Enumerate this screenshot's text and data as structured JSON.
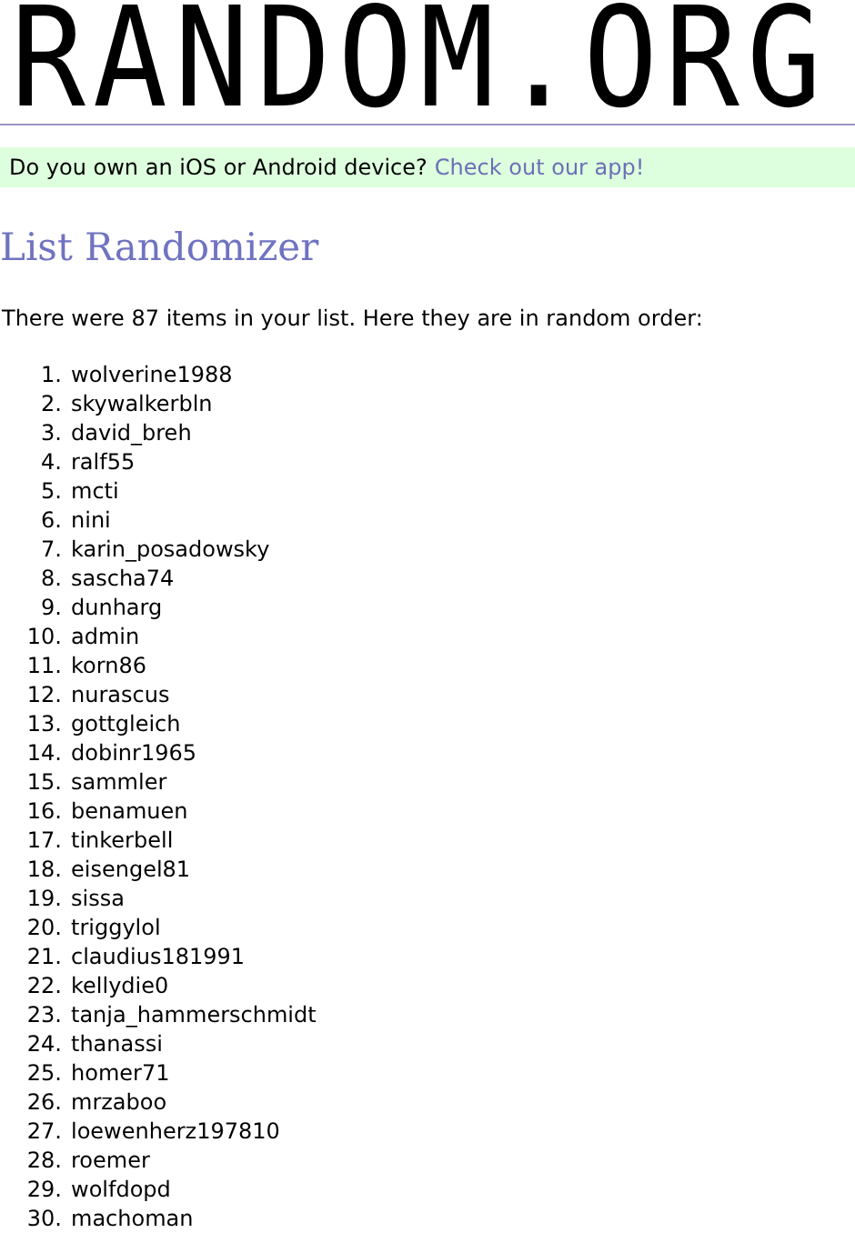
{
  "logo": "RANDOM.ORG",
  "banner": {
    "text": "Do you own an iOS or Android device?",
    "link": "Check out our app!"
  },
  "title": "List Randomizer",
  "intro": "There were 87 items in your list. Here they are in random order:",
  "items": [
    {
      "number": "1.",
      "name": "wolverine1988"
    },
    {
      "number": "2.",
      "name": "skywalkerbln"
    },
    {
      "number": "3.",
      "name": "david_breh"
    },
    {
      "number": "4.",
      "name": "ralf55"
    },
    {
      "number": "5.",
      "name": "mcti"
    },
    {
      "number": "6.",
      "name": "nini"
    },
    {
      "number": "7.",
      "name": "karin_posadowsky"
    },
    {
      "number": "8.",
      "name": "sascha74"
    },
    {
      "number": "9.",
      "name": "dunharg"
    },
    {
      "number": "10.",
      "name": "admin"
    },
    {
      "number": "11.",
      "name": "korn86"
    },
    {
      "number": "12.",
      "name": "nurascus"
    },
    {
      "number": "13.",
      "name": "gottgleich"
    },
    {
      "number": "14.",
      "name": "dobinr1965"
    },
    {
      "number": "15.",
      "name": "sammler"
    },
    {
      "number": "16.",
      "name": "benamuen"
    },
    {
      "number": "17.",
      "name": "tinkerbell"
    },
    {
      "number": "18.",
      "name": "eisengel81"
    },
    {
      "number": "19.",
      "name": "sissa"
    },
    {
      "number": "20.",
      "name": "triggylol"
    },
    {
      "number": "21.",
      "name": "claudius181991"
    },
    {
      "number": "22.",
      "name": "kellydie0"
    },
    {
      "number": "23.",
      "name": "tanja_hammerschmidt"
    },
    {
      "number": "24.",
      "name": "thanassi"
    },
    {
      "number": "25.",
      "name": "homer71"
    },
    {
      "number": "26.",
      "name": "mrzaboo"
    },
    {
      "number": "27.",
      "name": "loewenherz197810"
    },
    {
      "number": "28.",
      "name": "roemer"
    },
    {
      "number": "29.",
      "name": "wolfdopd"
    },
    {
      "number": "30.",
      "name": "machoman"
    }
  ]
}
